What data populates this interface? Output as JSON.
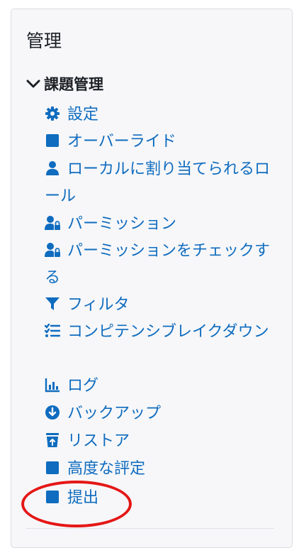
{
  "block": {
    "title": "管理",
    "section_label": "課題管理",
    "items": [
      {
        "label": "設定",
        "icon": "gear-icon"
      },
      {
        "label": "オーバーライド",
        "icon": "square-icon"
      },
      {
        "label": "ローカルに割り当てられるロール",
        "icon": "user-icon"
      },
      {
        "label": "パーミッション",
        "icon": "user-lock-icon"
      },
      {
        "label": "パーミッションをチェックする",
        "icon": "user-lock-icon"
      },
      {
        "label": "フィルタ",
        "icon": "filter-icon"
      },
      {
        "label": "コンピテンシブレイクダウン",
        "icon": "list-check-icon"
      },
      {
        "label": "ログ",
        "icon": "bar-chart-icon"
      },
      {
        "label": "バックアップ",
        "icon": "download-circle-icon"
      },
      {
        "label": "リストア",
        "icon": "trash-restore-icon"
      },
      {
        "label": "高度な評定",
        "icon": "square-icon"
      },
      {
        "label": "提出",
        "icon": "square-icon"
      }
    ]
  },
  "colors": {
    "link": "#0f6cbf",
    "highlight": "#e51717"
  }
}
